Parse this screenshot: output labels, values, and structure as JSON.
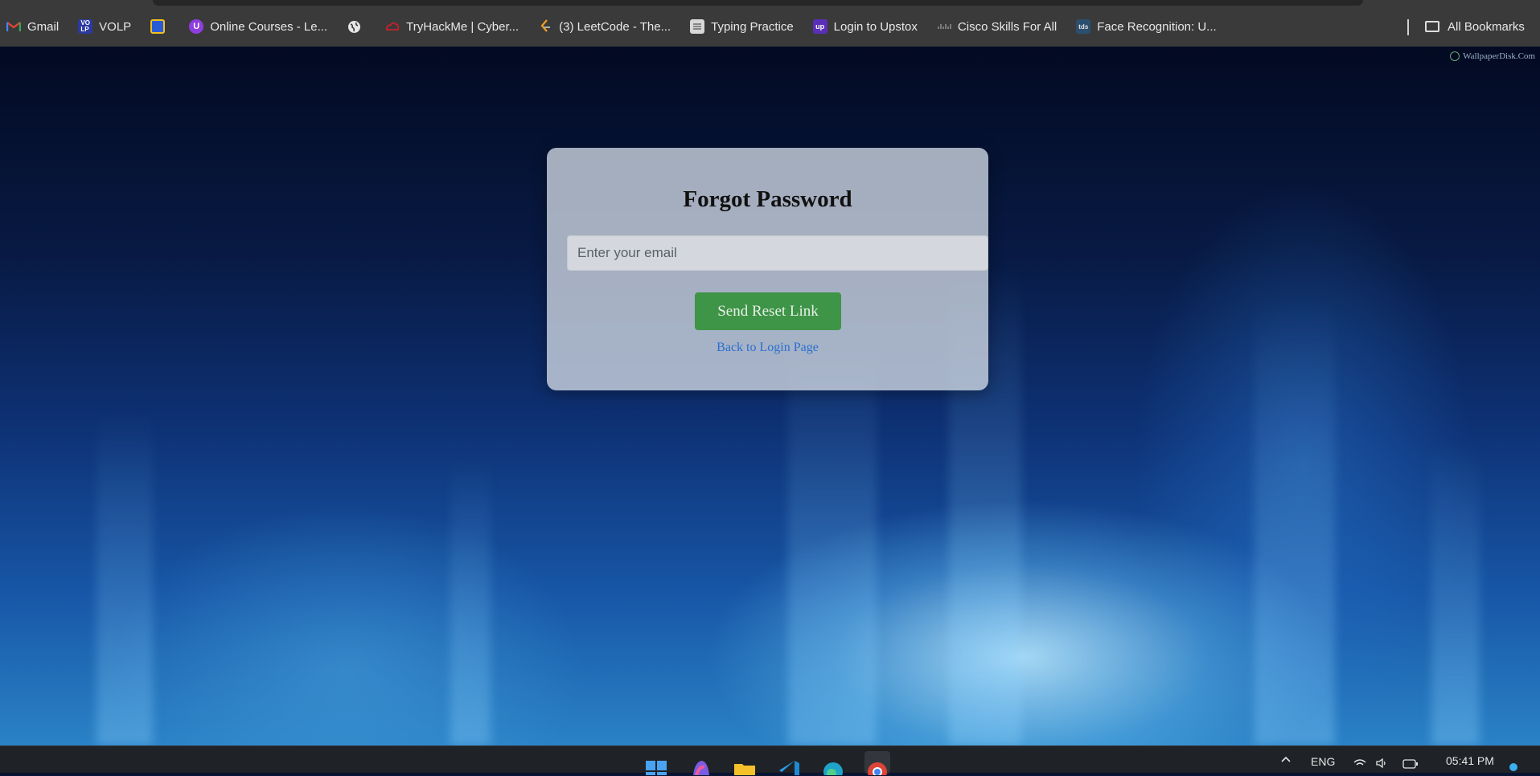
{
  "bookmarks": [
    {
      "label": "Gmail",
      "icon": "gmail-icon"
    },
    {
      "label": "VOLP",
      "icon": "volp-icon"
    },
    {
      "label": "",
      "icon": "app-icon"
    },
    {
      "label": "Online Courses - Le...",
      "icon": "udemy-icon"
    },
    {
      "label": "",
      "icon": "globe-icon"
    },
    {
      "label": "TryHackMe | Cyber...",
      "icon": "tryhackme-icon"
    },
    {
      "label": "(3) LeetCode - The...",
      "icon": "leetcode-icon"
    },
    {
      "label": "Typing Practice",
      "icon": "keyboard-icon"
    },
    {
      "label": "Login to Upstox",
      "icon": "upstox-icon"
    },
    {
      "label": "Cisco Skills For All",
      "icon": "cisco-icon"
    },
    {
      "label": "Face Recognition: U...",
      "icon": "tds-icon"
    }
  ],
  "all_bookmarks_label": "All Bookmarks",
  "watermark": "WallpaperDisk.Com",
  "form": {
    "title": "Forgot Password",
    "email_placeholder": "Enter your email",
    "email_value": "",
    "submit_label": "Send Reset Link",
    "back_link": "Back to Login Page"
  },
  "taskbar": {
    "apps": [
      "windows-start-icon",
      "copilot-icon",
      "file-explorer-icon",
      "vscode-icon",
      "edge-icon",
      "chrome-icon"
    ],
    "language": "ENG",
    "time": "05:41 PM"
  },
  "colors": {
    "button": "#3e9447",
    "link": "#2a6fcf",
    "bookmarks_bar": "#3a3a3a",
    "taskbar": "#1f2226"
  }
}
